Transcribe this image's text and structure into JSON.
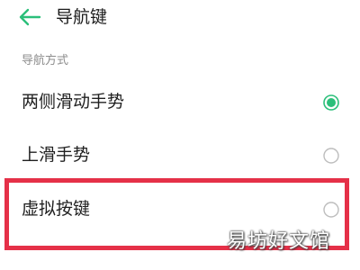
{
  "header": {
    "title": "导航键",
    "back_icon": "back-arrow-icon",
    "accent_color": "#2bbf7a"
  },
  "section": {
    "label": "导航方式"
  },
  "options": [
    {
      "label": "两侧滑动手势",
      "selected": true
    },
    {
      "label": "上滑手势",
      "selected": false
    },
    {
      "label": "虚拟按键",
      "selected": false
    }
  ],
  "highlight_color": "#e53048",
  "watermark": "易坊好文馆"
}
